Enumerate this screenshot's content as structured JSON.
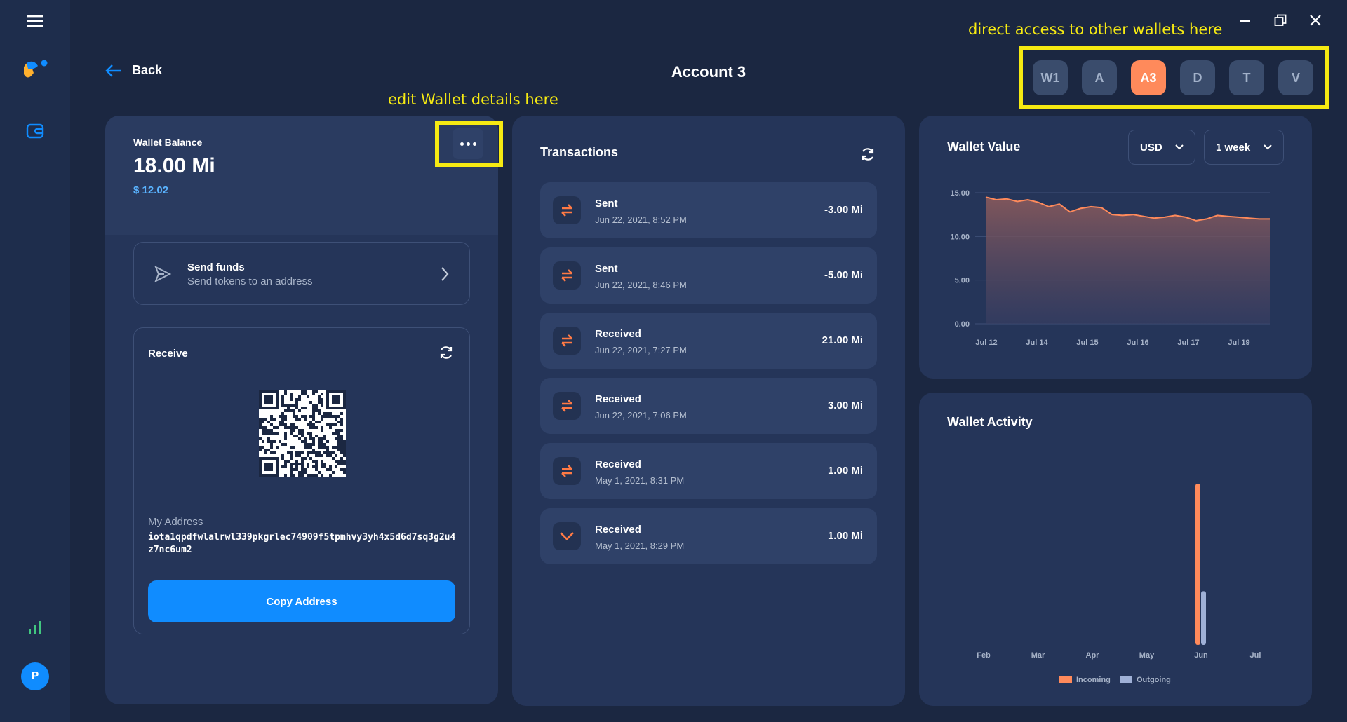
{
  "header": {
    "back_label": "Back",
    "title": "Account 3"
  },
  "annotations": {
    "wallets_hint": "direct access to other wallets here",
    "edit_hint": "edit Wallet details here"
  },
  "wallet_tabs": [
    {
      "label": "W1",
      "active": false
    },
    {
      "label": "A",
      "active": false
    },
    {
      "label": "A3",
      "active": true
    },
    {
      "label": "D",
      "active": false
    },
    {
      "label": "T",
      "active": false
    },
    {
      "label": "V",
      "active": false
    }
  ],
  "sidebar": {
    "avatar_initial": "P"
  },
  "balance": {
    "label": "Wallet Balance",
    "amount": "18.00 Mi",
    "fiat": "$ 12.02"
  },
  "send": {
    "title": "Send funds",
    "subtitle": "Send tokens to an address"
  },
  "receive": {
    "title": "Receive",
    "address_label": "My Address",
    "address": "iota1qpdfwlalrwl339pkgrlec74909f5tpmhvy3yh4x5d6d7sq3g2u4z7nc6um2",
    "copy_label": "Copy Address"
  },
  "transactions": {
    "title": "Transactions",
    "items": [
      {
        "type": "Sent",
        "date": "Jun 22, 2021, 8:52 PM",
        "amount": "-3.00 Mi",
        "icon": "swap-icon"
      },
      {
        "type": "Sent",
        "date": "Jun 22, 2021, 8:46 PM",
        "amount": "-5.00 Mi",
        "icon": "swap-icon"
      },
      {
        "type": "Received",
        "date": "Jun 22, 2021, 7:27 PM",
        "amount": "21.00 Mi",
        "icon": "swap-icon"
      },
      {
        "type": "Received",
        "date": "Jun 22, 2021, 7:06 PM",
        "amount": "3.00 Mi",
        "icon": "swap-icon"
      },
      {
        "type": "Received",
        "date": "May 1, 2021, 8:31 PM",
        "amount": "1.00 Mi",
        "icon": "swap-icon"
      },
      {
        "type": "Received",
        "date": "May 1, 2021, 8:29 PM",
        "amount": "1.00 Mi",
        "icon": "chevron-down-icon"
      }
    ]
  },
  "wallet_value": {
    "title": "Wallet Value",
    "currency": "USD",
    "range": "1 week"
  },
  "wallet_activity": {
    "title": "Wallet Activity"
  },
  "colors": {
    "accent": "#108cff",
    "incoming": "#ff8a5b",
    "outgoing": "#9fb0d6",
    "annotation": "#f6ea12"
  },
  "chart_data": [
    {
      "type": "area",
      "title": "Wallet Value",
      "x_ticks": [
        "Jul 12",
        "Jul 14",
        "Jul 15",
        "Jul 16",
        "Jul 17",
        "Jul 19"
      ],
      "y_ticks": [
        "15.00",
        "10.00",
        "5.00",
        "0.00"
      ],
      "ylim": [
        0,
        15
      ],
      "series": [
        {
          "values": [
            14.5,
            14.2,
            14.3,
            14.0,
            14.2,
            13.9,
            13.4,
            13.7,
            12.8,
            13.2,
            13.4,
            13.3,
            12.5,
            12.4,
            12.5,
            12.3,
            12.1,
            12.2,
            12.4,
            12.2,
            11.8,
            12.0,
            12.4,
            12.3,
            12.2,
            12.1,
            12.0,
            12.0
          ]
        }
      ],
      "grid": true
    },
    {
      "type": "bar",
      "title": "Wallet Activity",
      "categories": [
        "Feb",
        "Mar",
        "Apr",
        "May",
        "Jun",
        "Jul"
      ],
      "series": [
        {
          "name": "Incoming",
          "values": [
            0,
            0,
            0,
            0,
            30,
            0
          ]
        },
        {
          "name": "Outgoing",
          "values": [
            0,
            0,
            0,
            0,
            10,
            0
          ]
        }
      ]
    }
  ]
}
